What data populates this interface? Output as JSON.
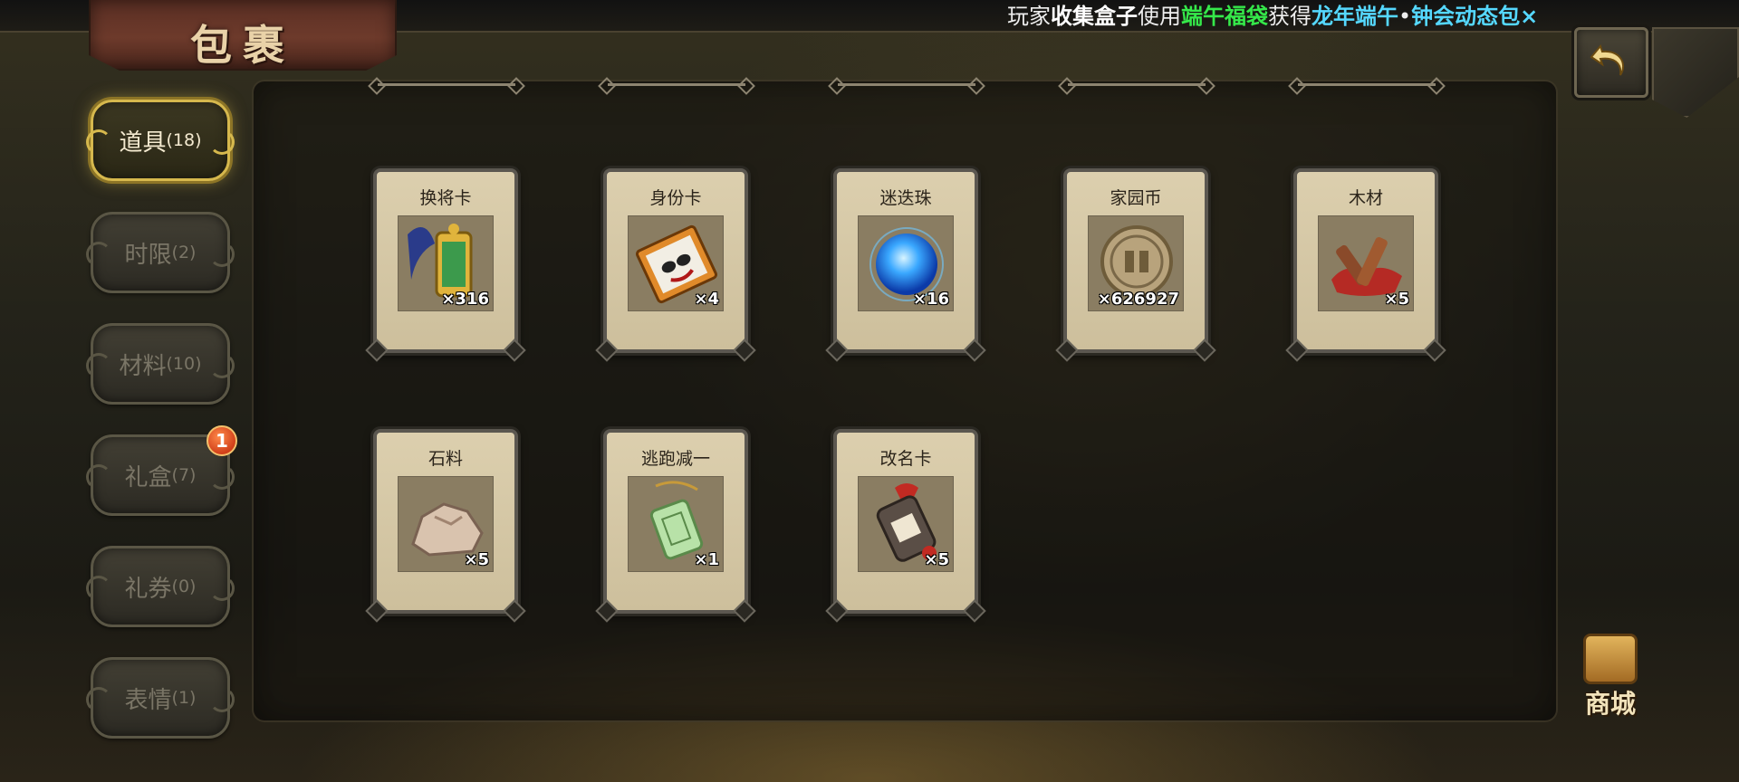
{
  "header": {
    "title": "包裹",
    "marquee": [
      {
        "text": "玩家",
        "style": "white"
      },
      {
        "text": "收集盒子",
        "style": "bold"
      },
      {
        "text": "使用",
        "style": "white"
      },
      {
        "text": "端午福袋",
        "style": "green"
      },
      {
        "text": "获得",
        "style": "white"
      },
      {
        "text": "龙年端午",
        "style": "cyan"
      },
      {
        "text": "•",
        "style": "white"
      },
      {
        "text": "钟会动态包×",
        "style": "cyan"
      }
    ],
    "back_icon": "back-arrow-icon"
  },
  "sidebar": {
    "tabs": [
      {
        "label": "道具",
        "count": "(18)",
        "active": true
      },
      {
        "label": "时限",
        "count": "(2)",
        "active": false
      },
      {
        "label": "材料",
        "count": "(10)",
        "active": false
      },
      {
        "label": "礼盒",
        "count": "(7)",
        "active": false,
        "badge": "1"
      },
      {
        "label": "礼券",
        "count": "(0)",
        "active": false
      },
      {
        "label": "表情",
        "count": "(1)",
        "active": false
      }
    ]
  },
  "items": [
    {
      "name": "换将卡",
      "qty": "×316",
      "icon": "token-card-icon"
    },
    {
      "name": "身份卡",
      "qty": "×4",
      "icon": "mask-card-icon"
    },
    {
      "name": "迷迭珠",
      "qty": "×16",
      "icon": "blue-orb-icon"
    },
    {
      "name": "家园币",
      "qty": "×626927",
      "icon": "coin-icon"
    },
    {
      "name": "木材",
      "qty": "×5",
      "icon": "wood-icon"
    },
    {
      "name": "石料",
      "qty": "×5",
      "icon": "stone-icon"
    },
    {
      "name": "逃跑减一",
      "qty": "×1",
      "icon": "jade-tag-icon"
    },
    {
      "name": "改名卡",
      "qty": "×5",
      "icon": "name-tag-icon"
    }
  ],
  "shop": {
    "label": "商城"
  },
  "colors": {
    "active_tab_border": "#d6b84d",
    "card_bg": "#dccfae",
    "badge": "#d1401a",
    "marquee_green": "#35e84a",
    "marquee_cyan": "#55d8ff"
  }
}
